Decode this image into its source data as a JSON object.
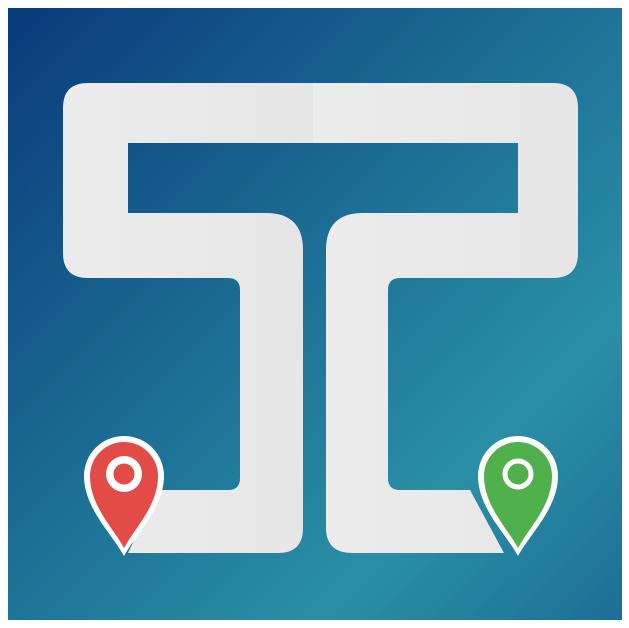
{
  "logo": {
    "name": "route-logo",
    "colors": {
      "bg_dark": "#0a3a7a",
      "bg_mid": "#1c6f95",
      "bg_light": "#2a8fa6",
      "road": "#ebebeb",
      "start_pin": "#e24b46",
      "end_pin": "#4fb04c",
      "pin_outline": "#ffffff"
    },
    "icons": [
      "start-pin-icon",
      "end-pin-icon",
      "road-path-icon"
    ]
  }
}
